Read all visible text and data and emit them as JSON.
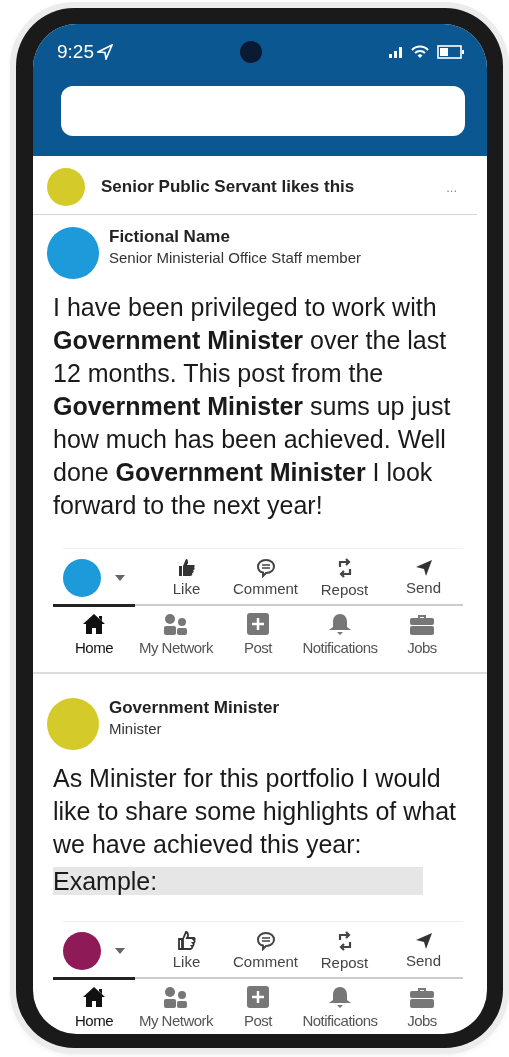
{
  "status_bar": {
    "time": "9:25"
  },
  "activity": {
    "text": "Senior Public Servant likes this",
    "color": "#d4cb2a",
    "more": "..."
  },
  "posts": [
    {
      "author": "Fictional Name",
      "role": "Senior Ministerial Office Staff member",
      "color": "#1d9ad9",
      "body": "I have been privileged to work with **Government Minister** over the last 12 months. This post from the **Government Minister** sums up just how much has been achieved. Well done **Government Minister** I look forward to the next year!",
      "reactor": {
        "color": "#1d9ad9"
      },
      "liked": true,
      "actions": [
        {
          "kind": "like",
          "label": "Like"
        },
        {
          "kind": "comment",
          "label": "Comment"
        },
        {
          "kind": "repost",
          "label": "Repost"
        },
        {
          "kind": "send",
          "label": "Send"
        }
      ],
      "tabs": [
        {
          "kind": "home",
          "label": "Home",
          "selected": true
        },
        {
          "kind": "network",
          "label": "My Network",
          "selected": false
        },
        {
          "kind": "post",
          "label": "Post",
          "selected": false
        },
        {
          "kind": "bell",
          "label": "Notifications",
          "selected": false
        },
        {
          "kind": "jobs",
          "label": "Jobs",
          "selected": false
        }
      ]
    },
    {
      "author": "Government Minister",
      "role": "Minister",
      "color": "#d4cb2a",
      "body": "As Minister for this portfolio I would like to share some highlights of what we have achieved this year:",
      "example": "Example:",
      "reactor": {
        "color": "#8e1a58"
      },
      "liked": false,
      "actions": [
        {
          "kind": "like",
          "label": "Like"
        },
        {
          "kind": "comment",
          "label": "Comment"
        },
        {
          "kind": "repost",
          "label": "Repost"
        },
        {
          "kind": "send",
          "label": "Send"
        }
      ],
      "tabs": [
        {
          "kind": "home",
          "label": "Home",
          "selected": true
        },
        {
          "kind": "network",
          "label": "My Network",
          "selected": false
        },
        {
          "kind": "post",
          "label": "Post",
          "selected": false
        },
        {
          "kind": "bell",
          "label": "Notifications",
          "selected": false
        },
        {
          "kind": "jobs",
          "label": "Jobs",
          "selected": false
        }
      ]
    }
  ]
}
